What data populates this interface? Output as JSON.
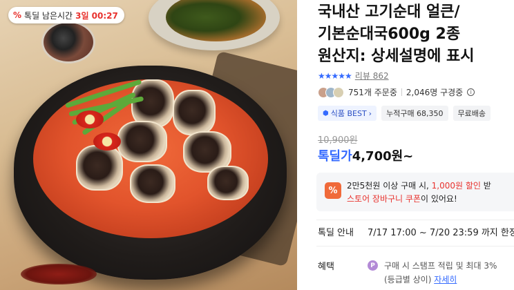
{
  "timer": {
    "icon": "percent-tag-icon",
    "label": "톡딜 남은시간",
    "value": "3일 00:27"
  },
  "product": {
    "title_lines": [
      "국내산 고기순대 얼큰/",
      "기본순대국600g 2종",
      "원산지: 상세설명에 표시"
    ],
    "rating": 5,
    "review_label": "리뷰",
    "review_count": "862",
    "order_count": "751개 주문중",
    "follow_count": "2,046명 구경중",
    "tags": [
      "식품 BEST",
      "누적구매 68,350",
      "무료배송"
    ],
    "original_price": "10,900원",
    "sale_label": "톡딜가",
    "sale_price": "4,700원~"
  },
  "coupon": {
    "line1_prefix": "2만5천원 이상 구매 시, ",
    "line1_highlight": "1,000원 할인",
    "line1_suffix": " 받",
    "line2_highlight": "스토어 장바구니 쿠폰",
    "line2_suffix": "이 있어요!"
  },
  "deal": {
    "label": "톡딜 안내",
    "period": "7/17 17:00 ~ 7/20 23:59 까지 한정"
  },
  "benefit": {
    "label": "혜택",
    "line1": "구매 시 스탬프 적립 및 최대 3%",
    "line2_prefix": "(등급별 상이) ",
    "line2_link": "자세히"
  },
  "colors": {
    "accent_blue": "#346aff",
    "accent_red": "#e8322e",
    "coupon_orange": "#f06a3a"
  }
}
